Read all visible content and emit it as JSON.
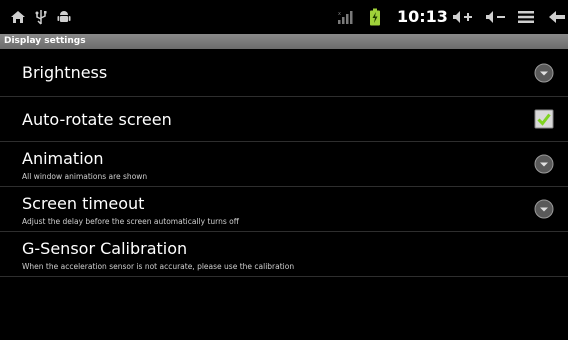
{
  "status_bar": {
    "time": "10:13",
    "icons": [
      "home-icon",
      "usb-icon",
      "android-debug-icon",
      "signal-icon",
      "battery-charging-icon",
      "volume-up-icon",
      "volume-down-icon",
      "menu-icon",
      "back-icon"
    ]
  },
  "header": {
    "title": "Display settings"
  },
  "settings": [
    {
      "title": "Brightness",
      "summary": "",
      "widget": "chevron-down-icon"
    },
    {
      "title": "Auto-rotate screen",
      "summary": "",
      "widget": "checkbox",
      "checked": true
    },
    {
      "title": "Animation",
      "summary": "All window animations are shown",
      "widget": "chevron-down-icon"
    },
    {
      "title": "Screen timeout",
      "summary": "Adjust the delay before the screen automatically turns off",
      "widget": "chevron-down-icon"
    },
    {
      "title": "G-Sensor Calibration",
      "summary": "When the acceleration sensor is not accurate, please use the calibration",
      "widget": "none"
    }
  ],
  "colors": {
    "check_green": "#7fd321",
    "accent": "#ffffff"
  }
}
